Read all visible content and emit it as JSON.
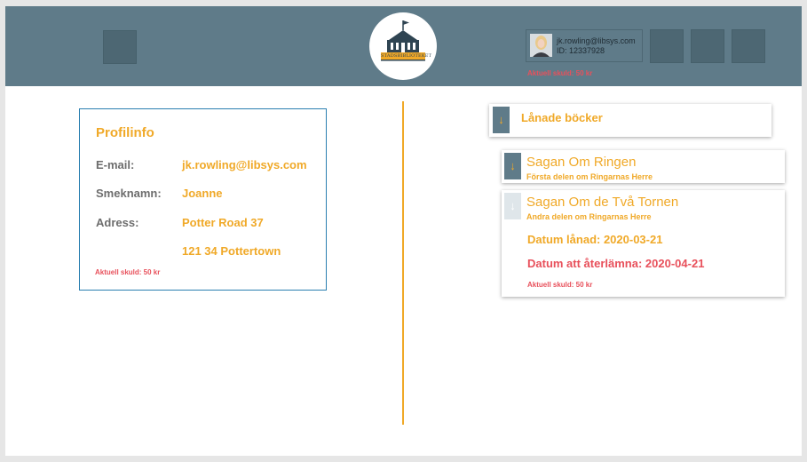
{
  "header": {
    "logo_text": "STADSBIBLIOTEKET",
    "user_email": "jk.rowling@libsys.com",
    "user_id": "ID: 12337928",
    "debt": "Aktuell skuld: 50 kr",
    "icons": [
      "header-button-icon",
      "library-logo-icon",
      "avatar"
    ]
  },
  "profile": {
    "title": "Profilinfo",
    "email_label": "E-mail:",
    "email_value": "jk.rowling@libsys.com",
    "nickname_label": "Smeknamn:",
    "nickname_value": "Joanne",
    "address_label": "Adress:",
    "address_line1": "Potter Road 37",
    "address_line2": "121 34 Pottertown",
    "debt": "Aktuell skuld: 50 kr"
  },
  "loans": {
    "title": "Lånade böcker",
    "arrow": "↓",
    "books": [
      {
        "title": "Sagan Om Ringen",
        "subtitle": "Första delen om Ringarnas Herre"
      },
      {
        "title": "Sagan Om de Två Tornen",
        "subtitle": "Andra delen om Ringarnas Herre",
        "loaned": "Datum lånad: 2020-03-21",
        "return": "Datum att återlämna: 2020-04-21",
        "debt": "Aktuell skuld: 50 kr"
      }
    ]
  },
  "colors": {
    "header_bg": "#5f7b89",
    "accent": "#f0a928",
    "warning": "#e8505b",
    "profile_border": "#2a7fb0"
  }
}
